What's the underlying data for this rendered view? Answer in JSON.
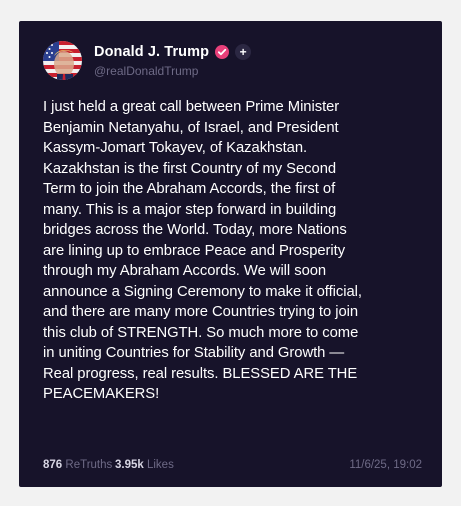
{
  "author": {
    "display_name": "Donald J. Trump",
    "handle": "@realDonaldTrump",
    "avatar_icon": "flag-portrait-avatar-icon",
    "verified_icon": "verified-badge-icon",
    "verified_color": "#e8407a",
    "follow_icon": "plus-icon",
    "follow_label": "+"
  },
  "post": {
    "text": "I just held a great call between Prime Minister\nBenjamin Netanyahu, of Israel, and President\nKassym-Jomart Tokayev, of Kazakhstan.\nKazakhstan is the first Country of my Second\nTerm to join the Abraham Accords, the first of\nmany. This is a major step forward in building\nbridges across the World. Today, more Nations\nare lining up to embrace Peace and Prosperity\nthrough my Abraham Accords. We will soon\nannounce a Signing Ceremony to make it official,\nand there are many more Countries trying to join\nthis club of STRENGTH. So much more to come\nin uniting Countries for Stability and Growth —\nReal progress, real results. BLESSED ARE THE\nPEACEMAKERS!"
  },
  "stats": {
    "retruths_count": "876",
    "retruths_label": "ReTruths",
    "likes_count": "3.95k",
    "likes_label": "Likes"
  },
  "timestamp": "11/6/25, 19:02",
  "colors": {
    "card_background": "#17132a",
    "page_background": "#f2f2f2",
    "text_primary": "#ffffff",
    "text_secondary": "#6e6a86"
  }
}
